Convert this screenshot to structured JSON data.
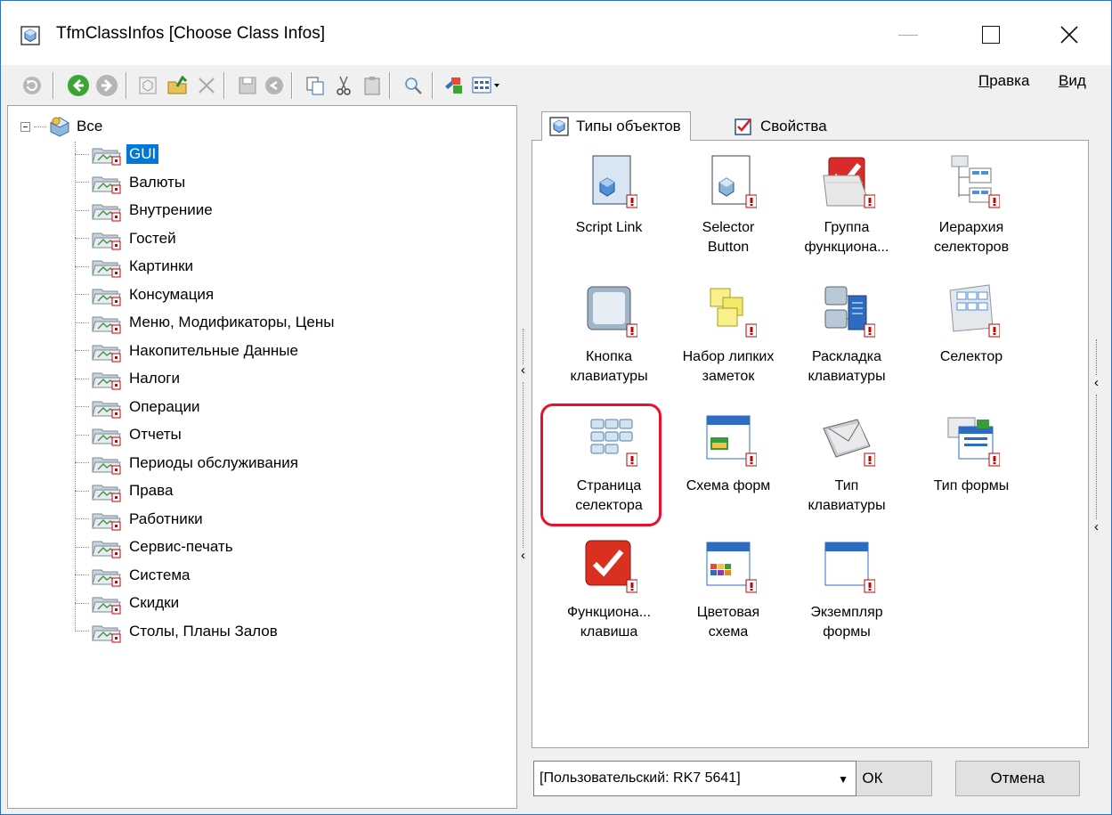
{
  "window": {
    "title": "TfmClassInfos [Choose Class Infos]"
  },
  "menu": {
    "edit_first": "П",
    "edit_rest": "равка",
    "view_first": "В",
    "view_rest": "ид"
  },
  "tree": {
    "root": "Все",
    "items": [
      "GUI",
      "Валюты",
      "Внутрениие",
      "Гостей",
      "Картинки",
      "Консумация",
      "Меню, Модификаторы, Цены",
      "Накопительные Данные",
      "Налоги",
      "Операции",
      "Отчеты",
      "Периоды обслуживания",
      "Права",
      "Работники",
      "Сервис-печать",
      "Система",
      "Скидки",
      "Столы, Планы Залов"
    ],
    "selected_index": 0
  },
  "tabs": [
    {
      "label": "Типы объектов",
      "active": true
    },
    {
      "label": "Свойства",
      "active": false
    }
  ],
  "object_types": [
    {
      "label": "Script Link",
      "icon": "script-link-icon"
    },
    {
      "label": "Selector\nButton",
      "icon": "selector-button-icon"
    },
    {
      "label": "Группа\nфункциона...",
      "icon": "function-group-icon"
    },
    {
      "label": "Иерархия\nселекторов",
      "icon": "selector-hierarchy-icon"
    },
    {
      "label": "Кнопка\nклавиатуры",
      "icon": "keyboard-button-icon"
    },
    {
      "label": "Набор липких\nзаметок",
      "icon": "sticky-notes-icon"
    },
    {
      "label": "Раскладка\nклавиатуры",
      "icon": "keyboard-layout-icon"
    },
    {
      "label": "Селектор",
      "icon": "selector-icon"
    },
    {
      "label": "Страница\nселектора",
      "icon": "selector-page-icon"
    },
    {
      "label": "Схема форм",
      "icon": "form-scheme-icon"
    },
    {
      "label": "Тип\nклавиатуры",
      "icon": "keyboard-type-icon"
    },
    {
      "label": "Тип формы",
      "icon": "form-type-icon"
    },
    {
      "label": "Функциона...\nклавиша",
      "icon": "function-key-icon"
    },
    {
      "label": "Цветовая\nсхема",
      "icon": "color-scheme-icon"
    },
    {
      "label": "Экземпляр\nформы",
      "icon": "form-instance-icon"
    }
  ],
  "footer": {
    "combo_value": "[Пользовательский: RK7 5641]",
    "ok_label": "ОК",
    "cancel_label": "Отмена"
  },
  "colors": {
    "selection": "#0078d7",
    "highlight_ring": "#e8112d",
    "window_border": "#2b73c5"
  }
}
